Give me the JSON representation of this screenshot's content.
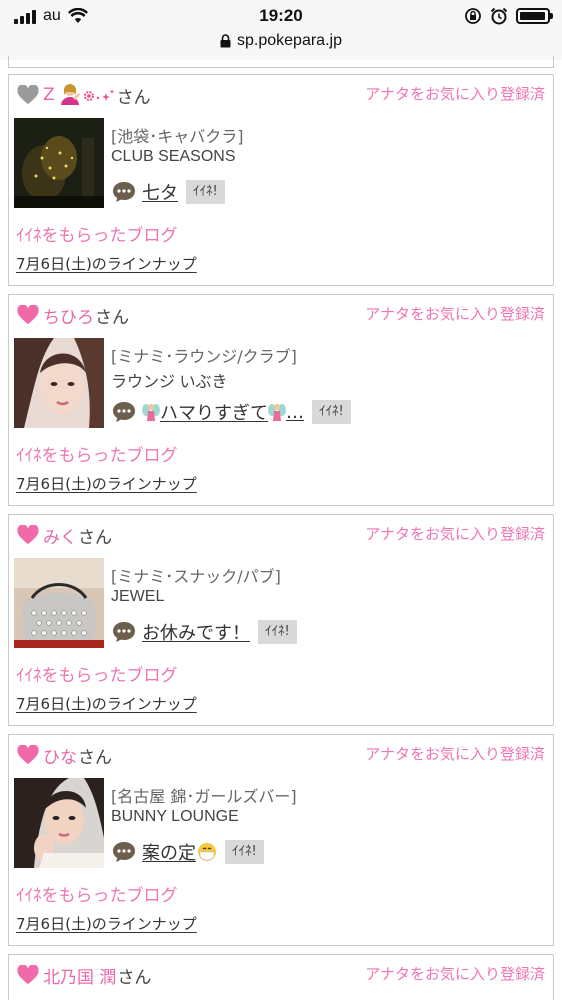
{
  "status_bar": {
    "carrier": "au",
    "time": "19:20",
    "battery_level": 0.95
  },
  "browser": {
    "url": "sp.pokepara.jp"
  },
  "labels": {
    "san": "さん",
    "fav_status": "アナタをお気に入り登録済",
    "iine": "ｲｲﾈ!",
    "liked_blog": "ｲｲﾈをもらったブログ",
    "lineup": "7月6日(土)のラインナップ"
  },
  "colors": {
    "accent_pink": "#ee75b3",
    "heart_pink": "#f06aaa",
    "heart_gray": "#9a9a9a",
    "button_gray": "#d9d9d9"
  },
  "cards": [
    {
      "name": "Z",
      "name_decorations": [
        "person-emoji",
        "sparkle-emoji"
      ],
      "heart_icon": "gray-heart-icon",
      "category": "[池袋･キャバクラ]",
      "shop": "CLUB SEASONS",
      "blog_title": "七タ",
      "thumb": "night-garden-photo"
    },
    {
      "name": "ちひろ",
      "heart_icon": "pink-heart-icon",
      "category": "[ミナミ･ラウンジ/クラブ]",
      "shop": "ラウンジ いぶき",
      "blog_title_text": "ハマりすぎて",
      "blog_title_suffix": "…",
      "blog_title_decorations": [
        "fairy-emoji",
        "fairy-emoji"
      ],
      "thumb": "portrait-photo"
    },
    {
      "name": "みく",
      "heart_icon": "pink-heart-icon",
      "category": "[ミナミ･スナック/パブ]",
      "shop": "JEWEL",
      "blog_title": "お休みです！",
      "thumb": "studded-bag-photo"
    },
    {
      "name": "ひな",
      "heart_icon": "pink-heart-icon",
      "category": "[名古屋 錦･ガールズバー]",
      "shop": "BUNNY LOUNGE",
      "blog_title": "案の定",
      "blog_title_decorations": [
        "mask-face-emoji"
      ],
      "thumb": "portrait-photo"
    },
    {
      "name": "北乃国 潤",
      "heart_icon": "pink-heart-icon"
    }
  ]
}
